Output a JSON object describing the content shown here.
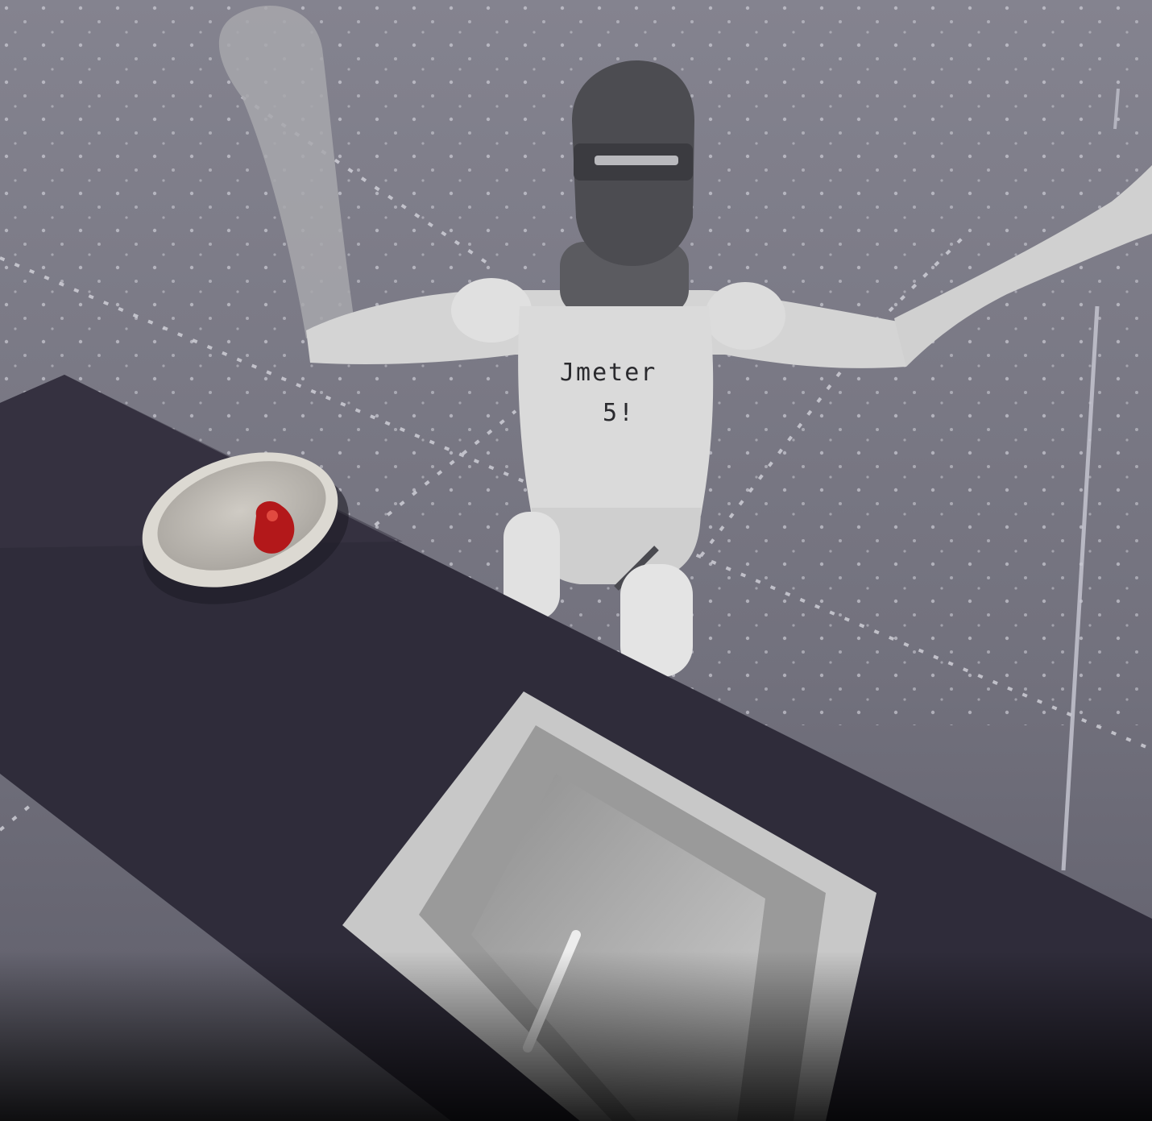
{
  "scene": {
    "description_tags": [
      "robot-mannequin",
      "bowl",
      "tray",
      "table"
    ],
    "colors": {
      "backdrop": "#72717d",
      "grid_dots": "#d8d8e0",
      "table": "#2f2c3a",
      "mannequin": "#d6d6d6",
      "head": "#4a4a4f",
      "bowl": "#d9d6d0",
      "object_in_bowl": "#b01818",
      "tray": "#bdbdbd"
    }
  },
  "robot": {
    "chest_text_line1": "Jmeter",
    "chest_text_line2": "5!"
  }
}
